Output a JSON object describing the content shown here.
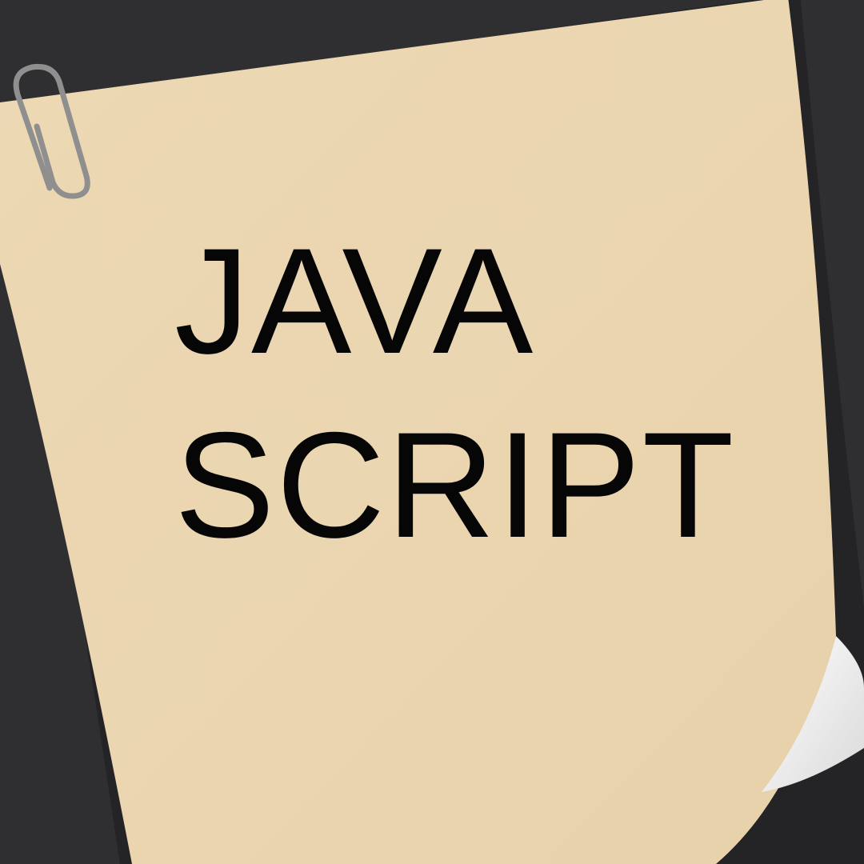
{
  "note": {
    "title_lines": [
      "JAVA",
      "SCRIPT"
    ]
  },
  "colors": {
    "background": "#2f2e31",
    "paper": "#ebd7b3",
    "text": "#060606",
    "paperclip": "#8f8f8f",
    "curl": "#f5f5f5"
  },
  "icons": [
    "paperclip-icon"
  ]
}
